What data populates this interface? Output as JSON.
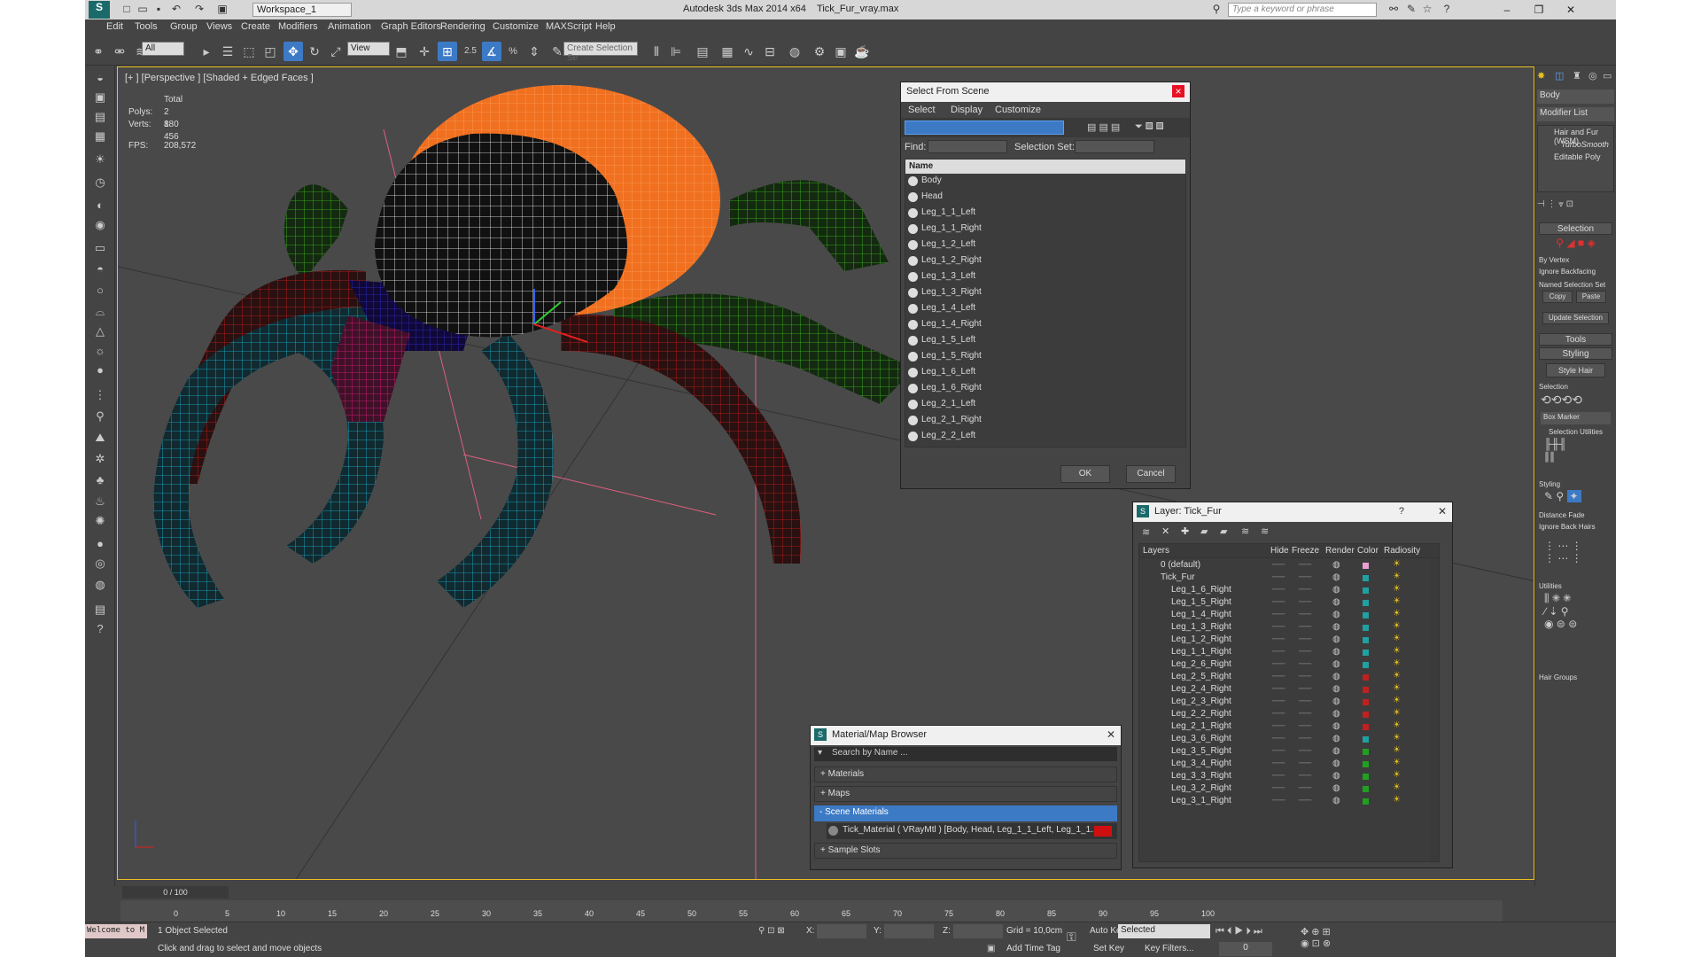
{
  "titlebar": {
    "workspace": "Workspace_1",
    "app_title": "Autodesk 3ds Max  2014 x64",
    "file": "Tick_Fur_vray.max",
    "search_placeholder": "Type a keyword or phrase"
  },
  "menu": [
    "Edit",
    "Tools",
    "Group",
    "Views",
    "Create",
    "Modifiers",
    "Animation",
    "Graph Editors",
    "Rendering",
    "Customize",
    "MAXScript",
    "Help"
  ],
  "toolbar": {
    "filter": "All",
    "ref_coord": "View",
    "selection_set": "Create Selection Se",
    "snap": "2.5",
    "percent": "%"
  },
  "viewport": {
    "label": "[+ ] [Perspective ] [Shaded + Edged Faces ]",
    "stats_header": "Total",
    "polys_label": "Polys:",
    "polys": "2 880",
    "verts_label": "Verts:",
    "verts": "1 456",
    "fps_label": "FPS:",
    "fps": "208,572"
  },
  "select_from_scene": {
    "title": "Select From Scene",
    "menus": [
      "Select",
      "Display",
      "Customize"
    ],
    "find_label": "Find:",
    "selection_set_label": "Selection Set:",
    "column": "Name",
    "items": [
      "Body",
      "Head",
      "Leg_1_1_Left",
      "Leg_1_1_Right",
      "Leg_1_2_Left",
      "Leg_1_2_Right",
      "Leg_1_3_Left",
      "Leg_1_3_Right",
      "Leg_1_4_Left",
      "Leg_1_4_Right",
      "Leg_1_5_Left",
      "Leg_1_5_Right",
      "Leg_1_6_Left",
      "Leg_1_6_Right",
      "Leg_2_1_Left",
      "Leg_2_1_Right",
      "Leg_2_2_Left"
    ],
    "ok": "OK",
    "cancel": "Cancel"
  },
  "layer_dialog": {
    "title": "Layer: Tick_Fur",
    "help": "?",
    "columns": [
      "Layers",
      "Hide",
      "Freeze",
      "Render",
      "Color",
      "Radiosity"
    ],
    "rows": [
      {
        "name": "0 (default)",
        "color": "#e8a0d0",
        "indent": 1
      },
      {
        "name": "Tick_Fur",
        "color": "#20a0a0",
        "indent": 1
      },
      {
        "name": "Leg_1_6_Right",
        "color": "#20a0a0",
        "indent": 2
      },
      {
        "name": "Leg_1_5_Right",
        "color": "#20a0a0",
        "indent": 2
      },
      {
        "name": "Leg_1_4_Right",
        "color": "#20a0a0",
        "indent": 2
      },
      {
        "name": "Leg_1_3_Right",
        "color": "#20a0a0",
        "indent": 2
      },
      {
        "name": "Leg_1_2_Right",
        "color": "#20a0a0",
        "indent": 2
      },
      {
        "name": "Leg_1_1_Right",
        "color": "#20a0a0",
        "indent": 2
      },
      {
        "name": "Leg_2_6_Right",
        "color": "#20a0a0",
        "indent": 2
      },
      {
        "name": "Leg_2_5_Right",
        "color": "#c02020",
        "indent": 2
      },
      {
        "name": "Leg_2_4_Right",
        "color": "#c02020",
        "indent": 2
      },
      {
        "name": "Leg_2_3_Right",
        "color": "#c02020",
        "indent": 2
      },
      {
        "name": "Leg_2_2_Right",
        "color": "#c02020",
        "indent": 2
      },
      {
        "name": "Leg_2_1_Right",
        "color": "#c02020",
        "indent": 2
      },
      {
        "name": "Leg_3_6_Right",
        "color": "#20a0a0",
        "indent": 2
      },
      {
        "name": "Leg_3_5_Right",
        "color": "#20a020",
        "indent": 2
      },
      {
        "name": "Leg_3_4_Right",
        "color": "#20a020",
        "indent": 2
      },
      {
        "name": "Leg_3_3_Right",
        "color": "#20a020",
        "indent": 2
      },
      {
        "name": "Leg_3_2_Right",
        "color": "#20a020",
        "indent": 2
      },
      {
        "name": "Leg_3_1_Right",
        "color": "#20a020",
        "indent": 2
      }
    ]
  },
  "material_browser": {
    "title": "Material/Map Browser",
    "search": "Search by Name ...",
    "sections": [
      "+ Materials",
      "+ Maps",
      "- Scene Materials",
      "+ Sample Slots"
    ],
    "material": "Tick_Material  ( VRayMtl ) [Body, Head, Leg_1_1_Left, Leg_1_1..."
  },
  "command_panel": {
    "object_name": "Body",
    "modifier_list": "Modifier List",
    "stack": [
      "Hair and Fur (WSM)",
      "TurboSmooth",
      "Editable Poly"
    ],
    "selection": "Selection",
    "by_vertex": "By Vertex",
    "ignore_backfacing": "Ignore Backfacing",
    "named_sel": "Named Selection Set",
    "copy": "Copy",
    "paste": "Paste",
    "update_selection": "Update Selection",
    "tools": "Tools",
    "styling": "Styling",
    "style_hair": "Style Hair",
    "selection2": "Selection",
    "box_marker": "Box Marker",
    "selection_utilities": "Selection Utilities",
    "styling2": "Styling",
    "distance_fade": "Distance Fade",
    "ignore_back_hairs": "Ignore Back Hairs",
    "utilities": "Utilities",
    "hair_groups": "Hair Groups"
  },
  "timeline": {
    "frame": "0 / 100",
    "ticks": [
      "0",
      "5",
      "10",
      "15",
      "20",
      "25",
      "30",
      "35",
      "40",
      "45",
      "50",
      "55",
      "60",
      "65",
      "70",
      "75",
      "80",
      "85",
      "90",
      "95",
      "100"
    ]
  },
  "status": {
    "welcome": "Welcome to M",
    "selected": "1 Object Selected",
    "prompt": "Click and drag to select and move objects",
    "x_label": "X:",
    "y_label": "Y:",
    "z_label": "Z:",
    "grid": "Grid = 10,0cm",
    "auto_key": "Auto Key",
    "set_key": "Set Key",
    "selected_dd": "Selected",
    "add_time_tag": "Add Time Tag",
    "key_filters": "Key Filters...",
    "frame_num": "0"
  }
}
